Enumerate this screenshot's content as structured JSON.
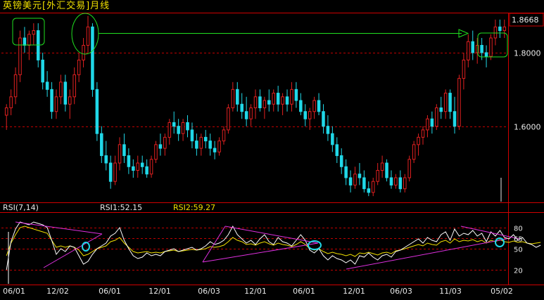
{
  "title": "英镑美元[外汇交易]月线",
  "colors": {
    "background": "#000000",
    "frame": "#d00000",
    "grid": "#c00000",
    "up_candle": "#e02020",
    "down_candle": "#20d8e8",
    "trend_arrow": "#20e020",
    "highlight_box": "#20e020",
    "rsi1_line": "#ffffff",
    "rsi2_line": "#f0e000",
    "trendline": "#e030e0",
    "circle": "#20d8e8",
    "axis_text": "#e8e8e8",
    "title_text": "#f0e000"
  },
  "rsi_header": {
    "name": "RSI(7,14)",
    "rsi1": "RSI1:52.15",
    "rsi2": "RSI2:59.27"
  },
  "chart_data": [
    {
      "type": "candlestick",
      "title": "英镑美元[外汇交易]月线",
      "ylim": [
        1.395,
        1.905
      ],
      "y_gridlines": [
        1.6,
        1.8
      ],
      "y_tick_labels": [
        "1.6000",
        "1.8000"
      ],
      "last_price_label": "1.8668",
      "x_tick_labels": [
        "06/01",
        "12/02",
        "06/01",
        "12/01",
        "06/03",
        "12/01",
        "06/01",
        "12/01",
        "06/03",
        "11/03",
        "05/02"
      ],
      "series": [
        {
          "name": "OHLC",
          "values": [
            [
              1.63,
              1.66,
              1.59,
              1.65
            ],
            [
              1.65,
              1.7,
              1.63,
              1.68
            ],
            [
              1.68,
              1.76,
              1.66,
              1.74
            ],
            [
              1.74,
              1.86,
              1.72,
              1.84
            ],
            [
              1.84,
              1.87,
              1.8,
              1.82
            ],
            [
              1.82,
              1.86,
              1.78,
              1.85
            ],
            [
              1.85,
              1.88,
              1.82,
              1.86
            ],
            [
              1.86,
              1.88,
              1.76,
              1.78
            ],
            [
              1.78,
              1.8,
              1.7,
              1.72
            ],
            [
              1.72,
              1.75,
              1.68,
              1.7
            ],
            [
              1.7,
              1.72,
              1.62,
              1.64
            ],
            [
              1.64,
              1.7,
              1.62,
              1.68
            ],
            [
              1.68,
              1.74,
              1.66,
              1.72
            ],
            [
              1.72,
              1.74,
              1.64,
              1.66
            ],
            [
              1.66,
              1.7,
              1.62,
              1.68
            ],
            [
              1.68,
              1.76,
              1.66,
              1.74
            ],
            [
              1.74,
              1.8,
              1.72,
              1.78
            ],
            [
              1.78,
              1.84,
              1.76,
              1.82
            ],
            [
              1.82,
              1.9,
              1.8,
              1.87
            ],
            [
              1.87,
              1.88,
              1.68,
              1.7
            ],
            [
              1.7,
              1.72,
              1.56,
              1.58
            ],
            [
              1.58,
              1.6,
              1.5,
              1.52
            ],
            [
              1.52,
              1.56,
              1.48,
              1.5
            ],
            [
              1.5,
              1.52,
              1.43,
              1.45
            ],
            [
              1.45,
              1.52,
              1.44,
              1.5
            ],
            [
              1.5,
              1.57,
              1.48,
              1.55
            ],
            [
              1.55,
              1.58,
              1.5,
              1.52
            ],
            [
              1.52,
              1.54,
              1.47,
              1.49
            ],
            [
              1.49,
              1.51,
              1.46,
              1.48
            ],
            [
              1.48,
              1.52,
              1.46,
              1.5
            ],
            [
              1.5,
              1.52,
              1.47,
              1.49
            ],
            [
              1.49,
              1.51,
              1.46,
              1.47
            ],
            [
              1.47,
              1.52,
              1.46,
              1.51
            ],
            [
              1.51,
              1.56,
              1.5,
              1.55
            ],
            [
              1.55,
              1.58,
              1.52,
              1.54
            ],
            [
              1.54,
              1.58,
              1.52,
              1.57
            ],
            [
              1.57,
              1.62,
              1.55,
              1.61
            ],
            [
              1.61,
              1.64,
              1.58,
              1.6
            ],
            [
              1.6,
              1.62,
              1.56,
              1.58
            ],
            [
              1.58,
              1.62,
              1.56,
              1.61
            ],
            [
              1.61,
              1.63,
              1.57,
              1.59
            ],
            [
              1.59,
              1.61,
              1.54,
              1.56
            ],
            [
              1.56,
              1.58,
              1.52,
              1.54
            ],
            [
              1.54,
              1.58,
              1.52,
              1.57
            ],
            [
              1.57,
              1.59,
              1.54,
              1.56
            ],
            [
              1.56,
              1.58,
              1.52,
              1.54
            ],
            [
              1.54,
              1.56,
              1.51,
              1.53
            ],
            [
              1.53,
              1.57,
              1.52,
              1.56
            ],
            [
              1.56,
              1.6,
              1.55,
              1.59
            ],
            [
              1.59,
              1.66,
              1.58,
              1.65
            ],
            [
              1.65,
              1.72,
              1.64,
              1.7
            ],
            [
              1.7,
              1.72,
              1.64,
              1.66
            ],
            [
              1.66,
              1.69,
              1.62,
              1.64
            ],
            [
              1.64,
              1.68,
              1.6,
              1.62
            ],
            [
              1.62,
              1.66,
              1.6,
              1.65
            ],
            [
              1.65,
              1.7,
              1.62,
              1.68
            ],
            [
              1.68,
              1.7,
              1.64,
              1.65
            ],
            [
              1.65,
              1.68,
              1.62,
              1.67
            ],
            [
              1.67,
              1.7,
              1.64,
              1.66
            ],
            [
              1.66,
              1.7,
              1.64,
              1.69
            ],
            [
              1.69,
              1.71,
              1.64,
              1.66
            ],
            [
              1.66,
              1.69,
              1.63,
              1.68
            ],
            [
              1.68,
              1.7,
              1.64,
              1.66
            ],
            [
              1.66,
              1.72,
              1.64,
              1.7
            ],
            [
              1.7,
              1.72,
              1.65,
              1.67
            ],
            [
              1.67,
              1.69,
              1.63,
              1.64
            ],
            [
              1.64,
              1.66,
              1.6,
              1.62
            ],
            [
              1.62,
              1.65,
              1.59,
              1.64
            ],
            [
              1.64,
              1.68,
              1.62,
              1.67
            ],
            [
              1.67,
              1.69,
              1.63,
              1.64
            ],
            [
              1.64,
              1.66,
              1.58,
              1.6
            ],
            [
              1.6,
              1.63,
              1.56,
              1.58
            ],
            [
              1.58,
              1.6,
              1.53,
              1.55
            ],
            [
              1.55,
              1.57,
              1.5,
              1.52
            ],
            [
              1.52,
              1.54,
              1.47,
              1.49
            ],
            [
              1.49,
              1.51,
              1.44,
              1.46
            ],
            [
              1.46,
              1.48,
              1.42,
              1.44
            ],
            [
              1.44,
              1.49,
              1.43,
              1.47
            ],
            [
              1.47,
              1.5,
              1.44,
              1.46
            ],
            [
              1.46,
              1.48,
              1.42,
              1.43
            ],
            [
              1.43,
              1.45,
              1.41,
              1.42
            ],
            [
              1.42,
              1.46,
              1.41,
              1.45
            ],
            [
              1.45,
              1.5,
              1.44,
              1.48
            ],
            [
              1.48,
              1.52,
              1.46,
              1.5
            ],
            [
              1.5,
              1.51,
              1.45,
              1.46
            ],
            [
              1.46,
              1.48,
              1.43,
              1.44
            ],
            [
              1.44,
              1.47,
              1.43,
              1.46
            ],
            [
              1.46,
              1.48,
              1.42,
              1.43
            ],
            [
              1.43,
              1.47,
              1.42,
              1.46
            ],
            [
              1.46,
              1.52,
              1.45,
              1.51
            ],
            [
              1.51,
              1.56,
              1.5,
              1.55
            ],
            [
              1.55,
              1.58,
              1.52,
              1.57
            ],
            [
              1.57,
              1.6,
              1.55,
              1.59
            ],
            [
              1.59,
              1.63,
              1.57,
              1.62
            ],
            [
              1.62,
              1.64,
              1.58,
              1.6
            ],
            [
              1.6,
              1.66,
              1.59,
              1.65
            ],
            [
              1.65,
              1.68,
              1.62,
              1.64
            ],
            [
              1.64,
              1.7,
              1.62,
              1.69
            ],
            [
              1.69,
              1.7,
              1.62,
              1.64
            ],
            [
              1.64,
              1.68,
              1.58,
              1.6
            ],
            [
              1.6,
              1.74,
              1.59,
              1.73
            ],
            [
              1.73,
              1.8,
              1.7,
              1.78
            ],
            [
              1.78,
              1.85,
              1.76,
              1.83
            ],
            [
              1.83,
              1.86,
              1.78,
              1.8
            ],
            [
              1.8,
              1.84,
              1.77,
              1.82
            ],
            [
              1.82,
              1.84,
              1.78,
              1.8
            ],
            [
              1.8,
              1.82,
              1.76,
              1.79
            ],
            [
              1.79,
              1.85,
              1.78,
              1.84
            ],
            [
              1.84,
              1.89,
              1.82,
              1.87
            ],
            [
              1.87,
              1.89,
              1.84,
              1.86
            ],
            [
              1.86,
              1.89,
              1.84,
              1.87
            ]
          ]
        }
      ]
    },
    {
      "type": "line",
      "title": "RSI(7,14)",
      "ylim": [
        0,
        100
      ],
      "y_gridlines": [
        20,
        50,
        65,
        80
      ],
      "y_tick_labels": [
        "20",
        "50",
        "65",
        "80"
      ],
      "series": [
        {
          "name": "RSI1",
          "values": [
            20,
            60,
            78,
            88,
            86,
            84,
            88,
            86,
            84,
            80,
            62,
            42,
            50,
            46,
            54,
            52,
            40,
            28,
            32,
            42,
            50,
            54,
            58,
            68,
            72,
            80,
            62,
            50,
            40,
            36,
            38,
            44,
            40,
            42,
            40,
            46,
            48,
            50,
            46,
            48,
            50,
            52,
            48,
            50,
            54,
            60,
            56,
            58,
            62,
            70,
            82,
            70,
            64,
            58,
            62,
            56,
            64,
            70,
            60,
            56,
            66,
            60,
            58,
            54,
            62,
            70,
            62,
            48,
            44,
            50,
            40,
            34,
            40,
            36,
            34,
            30,
            34,
            28,
            40,
            38,
            44,
            38,
            34,
            40,
            42,
            38,
            46,
            48,
            52,
            56,
            60,
            64,
            58,
            66,
            62,
            60,
            70,
            74,
            62,
            78,
            68,
            72,
            70,
            76,
            68,
            72,
            60,
            74,
            68,
            76,
            66,
            64,
            70,
            62,
            66,
            58,
            56,
            52,
            55
          ]
        },
        {
          "name": "RSI2",
          "values": [
            40,
            58,
            70,
            80,
            82,
            80,
            78,
            76,
            74,
            72,
            62,
            52,
            54,
            52,
            54,
            52,
            48,
            40,
            42,
            46,
            50,
            52,
            54,
            60,
            62,
            66,
            58,
            52,
            46,
            44,
            45,
            46,
            44,
            45,
            44,
            46,
            47,
            48,
            46,
            47,
            48,
            49,
            48,
            49,
            50,
            53,
            52,
            53,
            55,
            60,
            66,
            62,
            60,
            56,
            57,
            55,
            58,
            60,
            57,
            55,
            58,
            56,
            55,
            53,
            56,
            60,
            56,
            50,
            48,
            50,
            46,
            43,
            45,
            43,
            42,
            40,
            42,
            39,
            44,
            43,
            45,
            43,
            41,
            44,
            45,
            43,
            47,
            48,
            50,
            52,
            54,
            56,
            54,
            58,
            56,
            55,
            60,
            62,
            58,
            64,
            60,
            62,
            61,
            63,
            60,
            62,
            58,
            62,
            60,
            63,
            60,
            59,
            61,
            59,
            60,
            58,
            57,
            58,
            59
          ]
        }
      ]
    }
  ]
}
